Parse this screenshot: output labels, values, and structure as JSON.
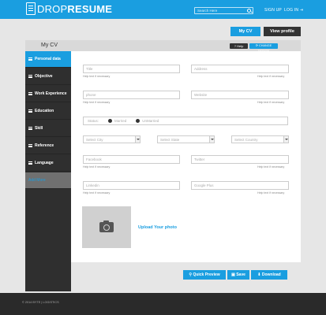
{
  "header": {
    "logo_light": "DROP",
    "logo_bold": "RESUME",
    "search_placeholder": "Search Here",
    "signup": "SIGN UP",
    "login": "LOG IN"
  },
  "toolbar": {
    "mycv": "My CV",
    "view_profile": "View profile"
  },
  "page": {
    "title": "My CV",
    "help": "Help",
    "change_design": "CHANGE DESIGN"
  },
  "sidebar": {
    "items": [
      {
        "label": "Personal data"
      },
      {
        "label": "Objective"
      },
      {
        "label": "Work Experience"
      },
      {
        "label": "Education"
      },
      {
        "label": "Skill"
      },
      {
        "label": "Reference"
      },
      {
        "label": "Language"
      },
      {
        "label": "Add More"
      }
    ]
  },
  "form": {
    "title_placeholder": "Title",
    "address_placeholder": "Address",
    "phone_placeholder": "phone",
    "website_placeholder": "Website",
    "help_text": "Help text if necessary",
    "status_label": "Status:",
    "married": "Married",
    "unmarried": "UnMarried",
    "city": "Select City",
    "state": "Select State",
    "country": "Select Country",
    "facebook": "Facebook",
    "twitter": "Twitter",
    "linkedin": "Linkedin",
    "google_plus": "Google Plus",
    "upload_photo": "Upload Your photo"
  },
  "actions": {
    "quick_preview": "Quick Preview",
    "save": "Save",
    "download": "Download"
  },
  "footer": {
    "copyright": "© 2014 BYTE | LOGISTICS"
  },
  "colors": {
    "accent": "#1a9ee0",
    "dark": "#2f2f2f",
    "footer": "#2a2a2a"
  }
}
